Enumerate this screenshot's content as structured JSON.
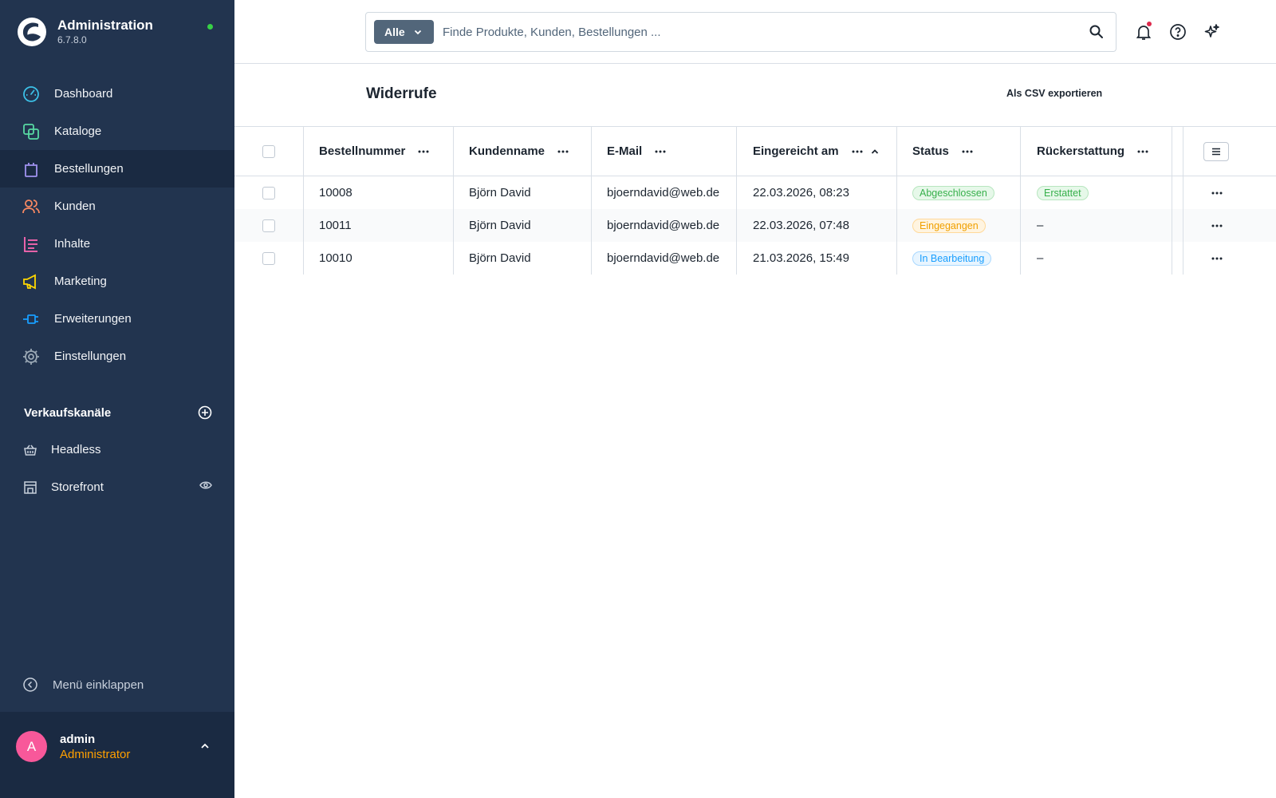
{
  "app": {
    "title": "Administration",
    "version": "6.7.8.0",
    "status_color": "#37d046"
  },
  "sidebar": {
    "items": [
      {
        "label": "Dashboard",
        "icon": "gauge-icon",
        "color": "#3cc1e8"
      },
      {
        "label": "Kataloge",
        "icon": "catalog-icon",
        "color": "#57d9a3"
      },
      {
        "label": "Bestellungen",
        "icon": "shopping-bag-icon",
        "color": "#a092f0",
        "active": true
      },
      {
        "label": "Kunden",
        "icon": "users-icon",
        "color": "#f88962"
      },
      {
        "label": "Inhalte",
        "icon": "content-icon",
        "color": "#ff68b4"
      },
      {
        "label": "Marketing",
        "icon": "megaphone-icon",
        "color": "#ffd700"
      },
      {
        "label": "Erweiterungen",
        "icon": "plug-icon",
        "color": "#189eff"
      },
      {
        "label": "Einstellungen",
        "icon": "gear-icon",
        "color": "#9aa8b5"
      }
    ],
    "sales_channels_heading": "Verkaufskanäle",
    "sales_channels": [
      {
        "label": "Headless",
        "icon": "basket-icon"
      },
      {
        "label": "Storefront",
        "icon": "storefront-icon"
      }
    ],
    "collapse_label": "Menü einklappen"
  },
  "user": {
    "initial": "A",
    "name": "admin",
    "role": "Administrator",
    "avatar_color": "#f8589a"
  },
  "search": {
    "type_label": "Alle",
    "placeholder": "Finde Produkte, Kunden, Bestellungen ..."
  },
  "page": {
    "title": "Widerrufe",
    "export_label": "Als CSV exportieren"
  },
  "table": {
    "columns": {
      "order_number": "Bestellnummer",
      "customer_name": "Kundenname",
      "email": "E-Mail",
      "submitted_at": "Eingereicht am",
      "status": "Status",
      "refund": "Rückerstattung"
    },
    "rows": [
      {
        "order_number": "10008",
        "customer_name": "Björn David",
        "email": "bjoerndavid@web.de",
        "submitted_at": "22.03.2026, 08:23",
        "status": "Abgeschlossen",
        "status_variant": "success",
        "refund": "Erstattet",
        "refund_badge": true
      },
      {
        "order_number": "10011",
        "customer_name": "Björn David",
        "email": "bjoerndavid@web.de",
        "submitted_at": "22.03.2026, 07:48",
        "status": "Eingegangen",
        "status_variant": "warning",
        "refund": "–",
        "refund_badge": false
      },
      {
        "order_number": "10010",
        "customer_name": "Björn David",
        "email": "bjoerndavid@web.de",
        "submitted_at": "21.03.2026, 15:49",
        "status": "In Bearbeitung",
        "status_variant": "info",
        "refund": "–",
        "refund_badge": false
      }
    ]
  }
}
